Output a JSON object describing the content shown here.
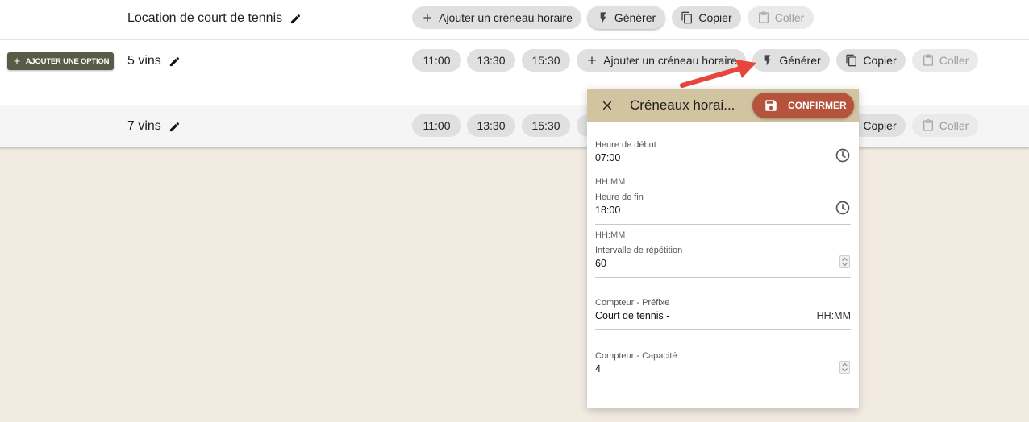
{
  "rows": [
    {
      "name": "Location de court de tennis",
      "buttons": {
        "add_slot": "Ajouter un créneau horaire",
        "generate": "Générer",
        "copy": "Copier",
        "paste": "Coller"
      }
    },
    {
      "name": "5 vins",
      "slots": [
        "11:00",
        "13:30",
        "15:30"
      ],
      "buttons": {
        "add_slot": "Ajouter un créneau horaire",
        "generate": "Générer",
        "copy": "Copier",
        "paste": "Coller"
      }
    },
    {
      "name": "7 vins",
      "slots": [
        "11:00",
        "13:30",
        "15:30"
      ],
      "buttons": {
        "copy": "Copier",
        "paste": "Coller"
      }
    }
  ],
  "add_option_label": "AJOUTER UNE OPTION",
  "dialog": {
    "title": "Créneaux horai...",
    "confirm_label": "CONFIRMER",
    "fields": {
      "start_time": {
        "label": "Heure de début",
        "value": "07:00",
        "hint": "HH:MM"
      },
      "end_time": {
        "label": "Heure de fin",
        "value": "18:00",
        "hint": "HH:MM"
      },
      "interval": {
        "label": "Intervalle de répétition",
        "value": "60"
      },
      "prefix": {
        "label": "Compteur - Préfixe",
        "value": "Court de tennis -",
        "suffix": "HH:MM"
      },
      "capacity": {
        "label": "Compteur - Capacité",
        "value": "4"
      }
    }
  },
  "colors": {
    "page_background": "#f2ebe2",
    "dialog_header": "#d2c3a1",
    "confirm_button": "#b5533d",
    "add_option_button": "#565c45",
    "annotation_arrow": "#e8453c"
  }
}
